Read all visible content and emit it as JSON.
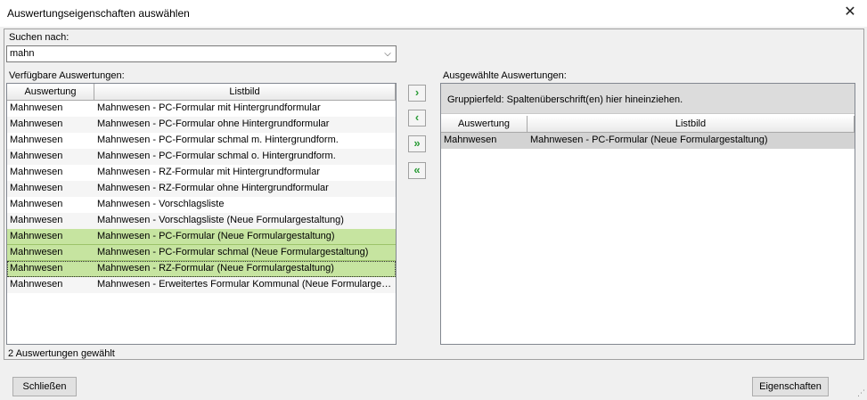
{
  "window": {
    "title": "Auswertungseigenschaften auswählen",
    "close_glyph": "✕"
  },
  "search": {
    "label": "Suchen nach:",
    "value": "mahn",
    "arrow_glyph": "⌵"
  },
  "available": {
    "label": "Verfügbare Auswertungen:",
    "columns": [
      "Auswertung",
      "Listbild"
    ],
    "rows": [
      {
        "auswertung": "Mahnwesen",
        "listbild": "Mahnwesen - PC-Formular mit Hintergrundformular",
        "selected": false
      },
      {
        "auswertung": "Mahnwesen",
        "listbild": "Mahnwesen - PC-Formular ohne Hintergrundformular",
        "selected": false
      },
      {
        "auswertung": "Mahnwesen",
        "listbild": "Mahnwesen - PC-Formular schmal m. Hintergrundform.",
        "selected": false
      },
      {
        "auswertung": "Mahnwesen",
        "listbild": "Mahnwesen - PC-Formular schmal o. Hintergrundform.",
        "selected": false
      },
      {
        "auswertung": "Mahnwesen",
        "listbild": "Mahnwesen - RZ-Formular mit Hintergrundformular",
        "selected": false
      },
      {
        "auswertung": "Mahnwesen",
        "listbild": "Mahnwesen - RZ-Formular ohne Hintergrundformular",
        "selected": false
      },
      {
        "auswertung": "Mahnwesen",
        "listbild": "Mahnwesen - Vorschlagsliste",
        "selected": false
      },
      {
        "auswertung": "Mahnwesen",
        "listbild": "Mahnwesen - Vorschlagsliste (Neue Formulargestaltung)",
        "selected": false
      },
      {
        "auswertung": "Mahnwesen",
        "listbild": "Mahnwesen - PC-Formular (Neue Formulargestaltung)",
        "selected": true
      },
      {
        "auswertung": "Mahnwesen",
        "listbild": "Mahnwesen - PC-Formular schmal (Neue Formulargestaltung)",
        "selected": true
      },
      {
        "auswertung": "Mahnwesen",
        "listbild": "Mahnwesen - RZ-Formular (Neue Formulargestaltung)",
        "selected": true,
        "focused": true
      },
      {
        "auswertung": "Mahnwesen",
        "listbild": "Mahnwesen - Erweitertes Formular Kommunal (Neue Formulargestaltung)",
        "selected": false
      }
    ],
    "status": "2 Auswertungen gewählt"
  },
  "move_buttons": [
    {
      "name": "move-right-button",
      "icon": "chevron-right-icon",
      "glyph": "›"
    },
    {
      "name": "move-left-button",
      "icon": "chevron-left-icon",
      "glyph": "‹"
    },
    {
      "name": "move-all-right-button",
      "icon": "double-chevron-right-icon",
      "glyph": "»"
    },
    {
      "name": "move-all-left-button",
      "icon": "double-chevron-left-icon",
      "glyph": "«"
    }
  ],
  "selected": {
    "label": "Ausgewählte Auswertungen:",
    "group_hint": "Gruppierfeld: Spaltenüberschrift(en) hier hineinziehen.",
    "columns": [
      "Auswertung",
      "Listbild"
    ],
    "rows": [
      {
        "auswertung": "Mahnwesen",
        "listbild": "Mahnwesen - PC-Formular (Neue Formulargestaltung)"
      }
    ]
  },
  "buttons": {
    "close": "Schließen",
    "properties": "Eigenschaften"
  },
  "colors": {
    "selection": "#c6e4a0",
    "arrow": "#2e9d3a"
  }
}
